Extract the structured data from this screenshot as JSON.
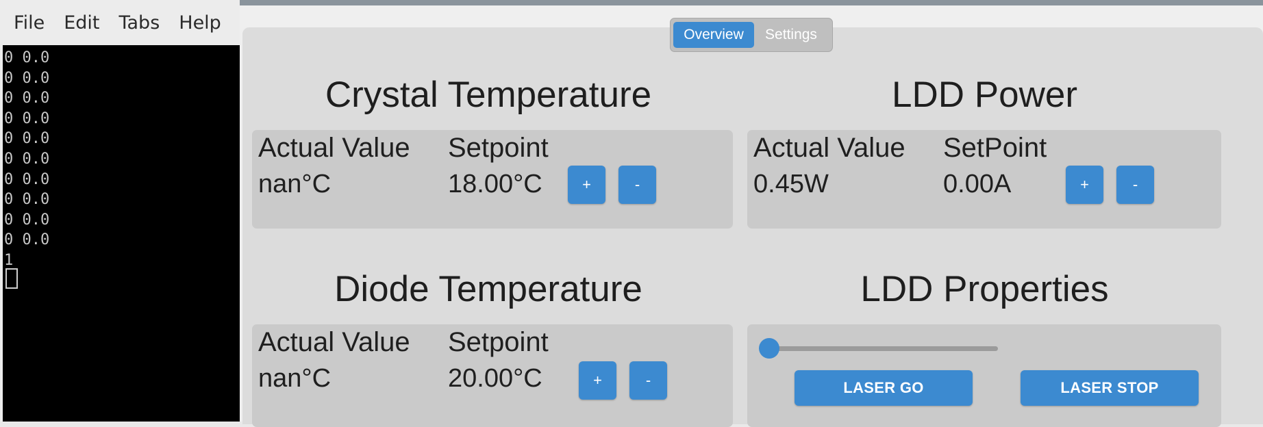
{
  "terminal": {
    "menu": [
      "File",
      "Edit",
      "Tabs",
      "Help"
    ],
    "lines": [
      "0 0.0",
      "0 0.0",
      "0 0.0",
      "0 0.0",
      "0 0.0",
      "0 0.0",
      "0 0.0",
      "0 0.0",
      "0 0.0",
      "0 0.0",
      "1"
    ]
  },
  "app": {
    "tabs": {
      "overview": "Overview",
      "settings": "Settings"
    },
    "crystal": {
      "title": "Crystal Temperature",
      "actual_label": "Actual Value",
      "actual_value": "nan°C",
      "setpoint_label": "Setpoint",
      "setpoint_value": "18.00°C",
      "plus": "+",
      "minus": "-"
    },
    "ldd_power": {
      "title": "LDD Power",
      "actual_label": "Actual Value",
      "actual_value": "0.45W",
      "setpoint_label": "SetPoint",
      "setpoint_value": "0.00A",
      "plus": "+",
      "minus": "-"
    },
    "diode": {
      "title": "Diode Temperature",
      "actual_label": "Actual Value",
      "actual_value": "nan°C",
      "setpoint_label": "Setpoint",
      "setpoint_value": "20.00°C",
      "plus": "+",
      "minus": "-"
    },
    "ldd_properties": {
      "title": "LDD Properties",
      "slider_value_fraction": 0.0,
      "laser_go": "LASER GO",
      "laser_stop": "LASER STOP"
    }
  },
  "colors": {
    "accent": "#3c8ad0",
    "terminal_bg": "#000000",
    "panel_bg": "#dcdcdc",
    "card_bg": "#cacaca"
  }
}
